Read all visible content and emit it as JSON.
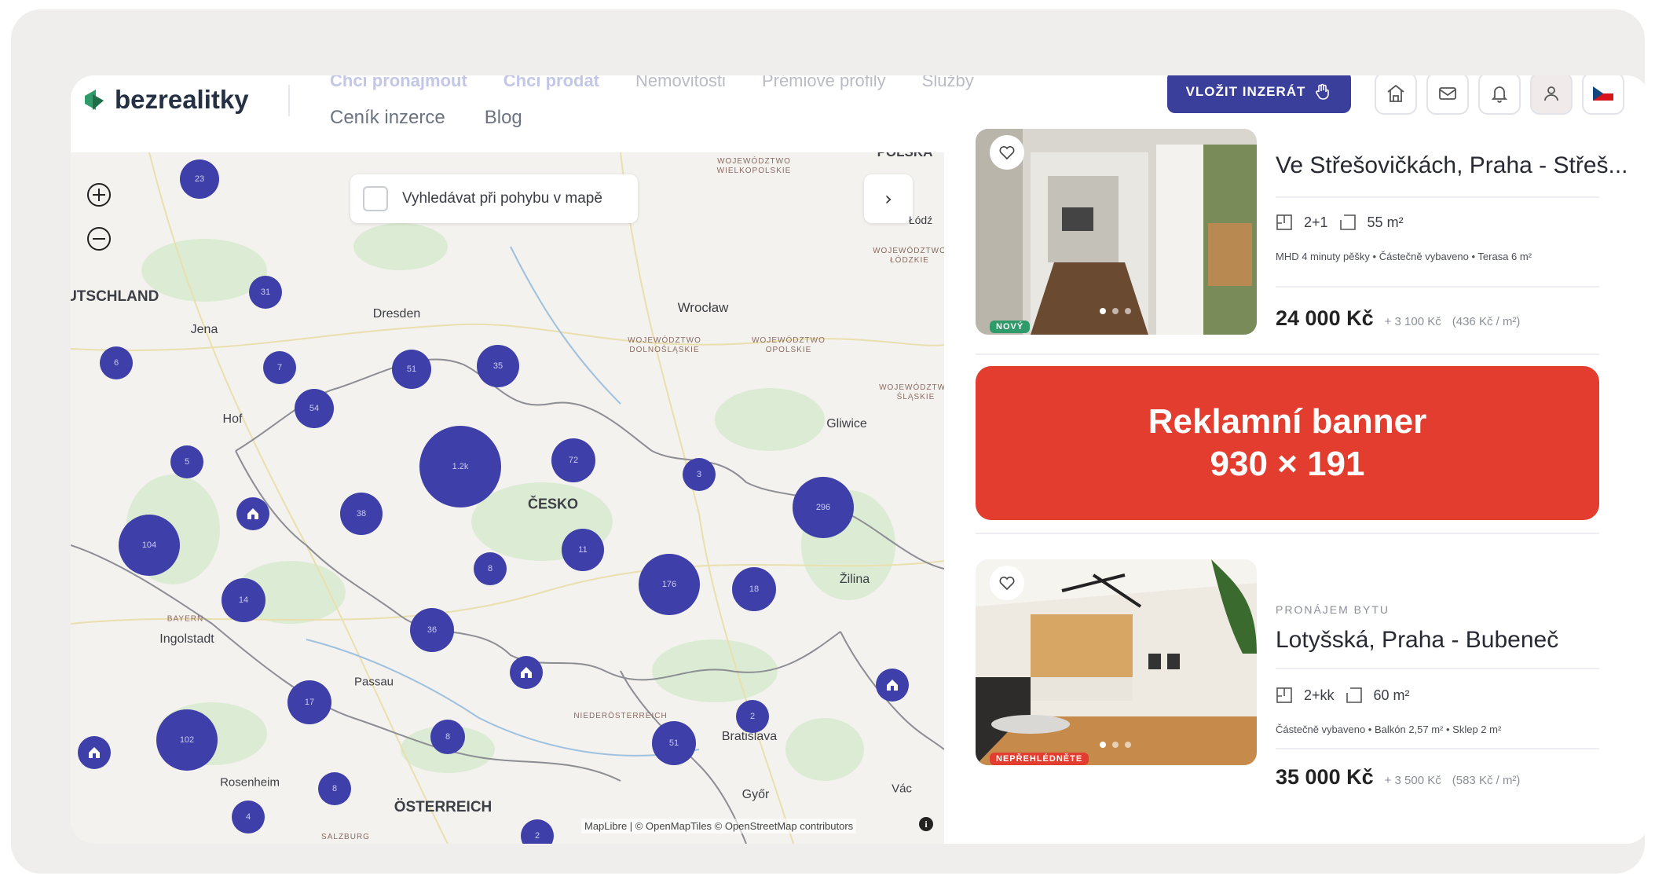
{
  "header": {
    "logo": "bezrealitky",
    "topnav": [
      "Chci pronajmout",
      "Chci prodat",
      "Nemovitosti",
      "Prémiové profily",
      "Služby"
    ],
    "subnav": [
      "Ceník inzerce",
      "Blog"
    ],
    "post_button": "VLOŽIT INZERÁT"
  },
  "map": {
    "search_on_move": "Vyhledávat při pohybu v mapě",
    "attribution": "MapLibre | © OpenMapTiles © OpenStreetMap contributors",
    "clusters": [
      "23",
      "31",
      "6",
      "7",
      "51",
      "35",
      "54",
      "5",
      "1.2k",
      "72",
      "3",
      "296",
      "104",
      "38",
      "11",
      "8",
      "176",
      "18",
      "14",
      "36",
      "17",
      "102",
      "8",
      "51",
      "2",
      "8",
      "4",
      "2"
    ],
    "places": [
      "DEUTSCHLAND",
      "Jena",
      "Dresden",
      "Wrocław",
      "Hof",
      "Gliwice",
      "ČESKO",
      "BAYERN",
      "Ingolstadt",
      "Passau",
      "Žilina",
      "Bratislava",
      "Rosenheim",
      "ÖSTERREICH",
      "Győr",
      "Vác",
      "Łódź",
      "POLSKA"
    ],
    "regions": [
      "WOJEWÓDZTWO\nWIELKOPOLSKIE",
      "WOJEWÓDZTWO\nŁÓDZKIE",
      "WOJEWÓDZTWO\nDOLNOŚLĄSKIE",
      "WOJEWÓDZTWO\nOPOLSKIE",
      "WOJEWÓDZTWO\nŚLĄSKIE",
      "NIEDERÖSTERREICH",
      "SALZBURG"
    ]
  },
  "listings": [
    {
      "badge": "NOVÝ",
      "badge_color": "#2f9a6a",
      "title": "Ve Střešovičkách, Praha - Střeš...",
      "rooms": "2+1",
      "area": "55 m²",
      "features": "MHD 4 minuty pěšky • Částečně vybaveno • Terasa 6 m²",
      "price": "24 000 Kč",
      "price_extra": "+ 3 100 Kč",
      "price_per_m": "(436 Kč / m²)"
    },
    {
      "badge": "NEPŘEHLÉDNĚTE",
      "badge_color": "#e23d2e",
      "type": "PRONÁJEM BYTU",
      "title": "Lotyšská, Praha - Bubeneč",
      "rooms": "2+kk",
      "area": "60 m²",
      "features": "Částečně vybaveno • Balkón 2,57 m² • Sklep 2 m²",
      "price": "35 000 Kč",
      "price_extra": "+ 3 500 Kč",
      "price_per_m": "(583 Kč / m²)"
    }
  ],
  "banner": {
    "line1": "Reklamní banner",
    "line2": "930 × 191",
    "color": "#e23d2e"
  },
  "colors": {
    "accent": "#3b3f9c",
    "cluster": "#3e3fa8"
  }
}
